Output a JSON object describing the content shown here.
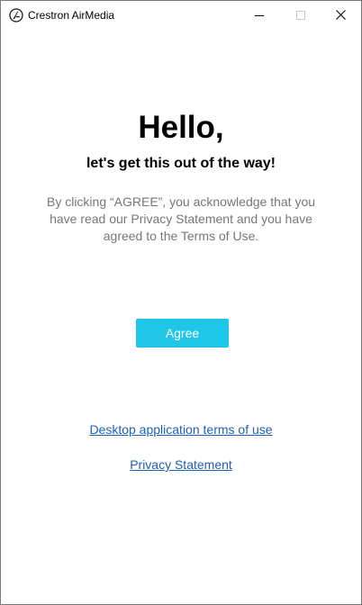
{
  "window": {
    "title": "Crestron AirMedia",
    "icon": "airmedia-logo-icon",
    "controls": {
      "minimize_icon": "minimize-icon",
      "maximize_icon": "maximize-icon",
      "close_icon": "close-icon"
    }
  },
  "main": {
    "heading": "Hello,",
    "subheading": "let's get this out of the way!",
    "consent_text": "By clicking “AGREE”, you acknowledge that you have read our Privacy Statement and you have agreed to the Terms of Use.",
    "agree_label": "Agree",
    "terms_link": "Desktop application terms of use",
    "privacy_link": "Privacy Statement"
  },
  "colors": {
    "accent": "#1ec7e8",
    "link": "#1f5fb5",
    "muted_text": "#777777"
  }
}
